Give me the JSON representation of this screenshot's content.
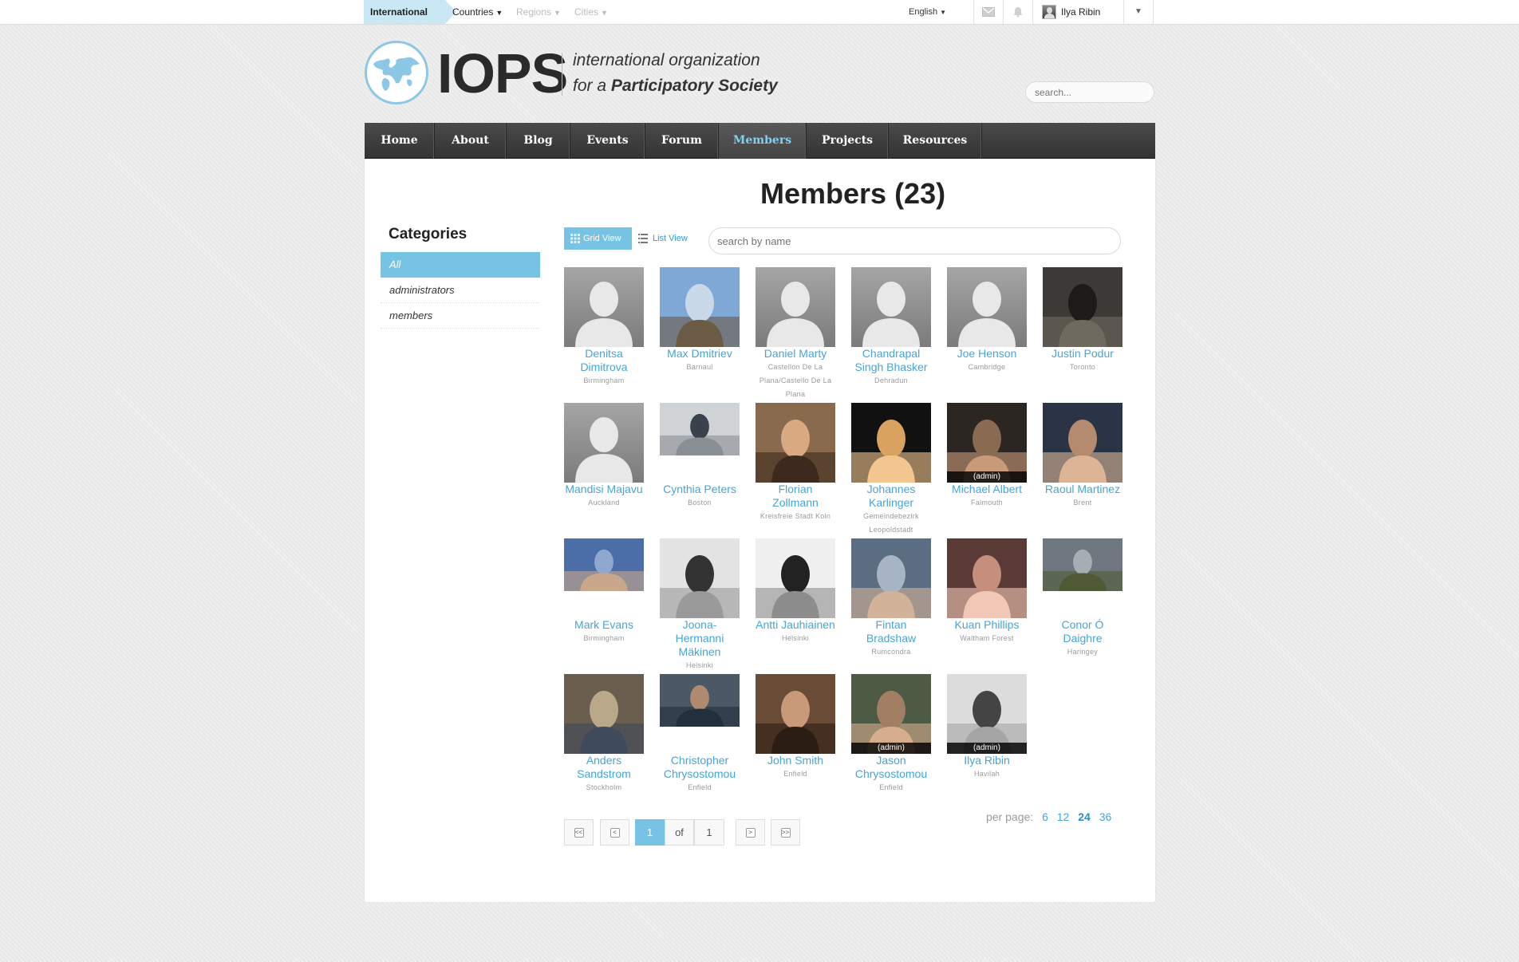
{
  "topbar": {
    "scope": "International",
    "countries": "Countries",
    "regions": "Regions",
    "cities": "Cities",
    "language": "English",
    "user_name": "Ilya Ribin"
  },
  "header": {
    "logo_text": "IOPS",
    "tagline_line1": "international organization",
    "tagline_line2_prefix": "for a",
    "tagline_line2_bold": "Participatory Society",
    "search_placeholder": "search..."
  },
  "nav": [
    "Home",
    "About",
    "Blog",
    "Events",
    "Forum",
    "Members",
    "Projects",
    "Resources"
  ],
  "nav_active": "Members",
  "page": {
    "title": "Members (23)"
  },
  "categories": {
    "title": "Categories",
    "items": [
      "All",
      "administrators",
      "members"
    ],
    "active": "All"
  },
  "view": {
    "grid_label": "Grid View",
    "list_label": "List View",
    "search_placeholder": "search by name"
  },
  "members": [
    {
      "name": "Denitsa Dimitrova",
      "city": "Birmingham",
      "photo": "default-silhouette"
    },
    {
      "name": "Max Dmitriev",
      "city": "Barnaul",
      "photo": "photo-sky"
    },
    {
      "name": "Daniel Marty",
      "city": "Castellon De La Plana/Castello De La Plana",
      "photo": "default-silhouette"
    },
    {
      "name": "Chandrapal Singh Bhasker",
      "city": "Dehradun",
      "photo": "default-silhouette"
    },
    {
      "name": "Joe Henson",
      "city": "Cambridge",
      "photo": "default-silhouette"
    },
    {
      "name": "Justin Podur",
      "city": "Toronto",
      "photo": "photo-dark"
    },
    {
      "name": "Mandisi Majavu",
      "city": "Auckland",
      "photo": "default-silhouette"
    },
    {
      "name": "Cynthia Peters",
      "city": "Boston",
      "photo": "photo-crowd"
    },
    {
      "name": "Florian Zollmann",
      "city": "Kreisfreie Stadt Koln",
      "photo": "photo-face-warm"
    },
    {
      "name": "Johannes Karlinger",
      "city": "Gemeindebezirk Leopoldstadt",
      "photo": "photo-3d-avatar"
    },
    {
      "name": "Michael Albert",
      "city": "Falmouth",
      "photo": "photo-face-dark",
      "admin": "(admin)"
    },
    {
      "name": "Raoul Martinez",
      "city": "Brent",
      "photo": "photo-face-night"
    },
    {
      "name": "Mark Evans",
      "city": "Birmingham",
      "photo": "photo-blue"
    },
    {
      "name": "Joona-Hermanni Mäkinen",
      "city": "Helsinki",
      "photo": "photo-bw-glasses"
    },
    {
      "name": "Antti Jauhiainen",
      "city": "Helsinki",
      "photo": "photo-bw-face"
    },
    {
      "name": "Fintan Bradshaw",
      "city": "Rumcondra",
      "photo": "photo-room"
    },
    {
      "name": "Kuan Phillips",
      "city": "Waltham Forest",
      "photo": "photo-face-red"
    },
    {
      "name": "Conor Ó Daighre",
      "city": "Haringey",
      "photo": "photo-landscape"
    },
    {
      "name": "Anders Sandstrom",
      "city": "Stockholm",
      "photo": "photo-street"
    },
    {
      "name": "Christopher Chrysostomou",
      "city": "Enfield",
      "photo": "photo-face-indoor"
    },
    {
      "name": "John Smith",
      "city": "Enfield",
      "photo": "photo-face-brown"
    },
    {
      "name": "Jason Chrysostomou",
      "city": "Enfield",
      "photo": "photo-face-outdoor",
      "admin": "(admin)"
    },
    {
      "name": "Ilya Ribin",
      "city": "Havilah",
      "photo": "photo-bw-smile",
      "admin": "(admin)"
    }
  ],
  "pagination": {
    "current": "1",
    "of_label": "of",
    "total": "1",
    "first_label": "<<",
    "prev_label": "<",
    "next_label": ">",
    "last_label": ">>",
    "per_page_label": "per page:",
    "per_page_options": [
      "6",
      "12",
      "24",
      "36"
    ],
    "per_page_selected": "24"
  }
}
